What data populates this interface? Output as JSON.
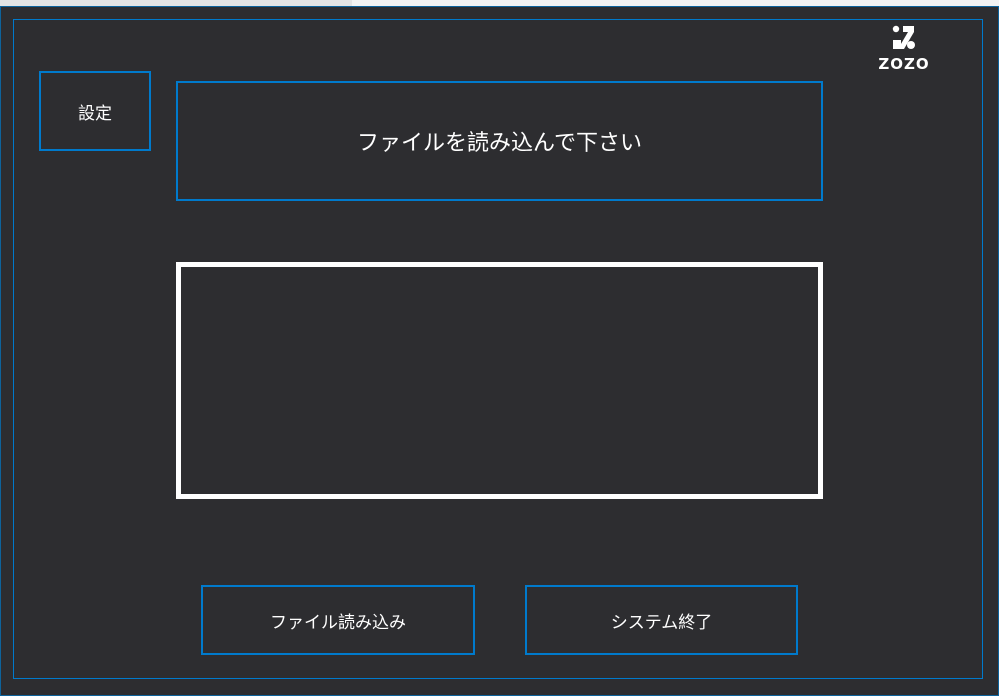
{
  "settings_button": {
    "label": "設定"
  },
  "message": {
    "text": "ファイルを読み込んで下さい"
  },
  "buttons": {
    "load_file": "ファイル読み込み",
    "exit_system": "システム終了"
  },
  "logo": {
    "text": "ZOZO",
    "icon": "zozo-logo-icon"
  },
  "colors": {
    "background": "#2d2d30",
    "accent_border": "#007acc",
    "display_border": "#ffffff",
    "text": "#ffffff"
  }
}
